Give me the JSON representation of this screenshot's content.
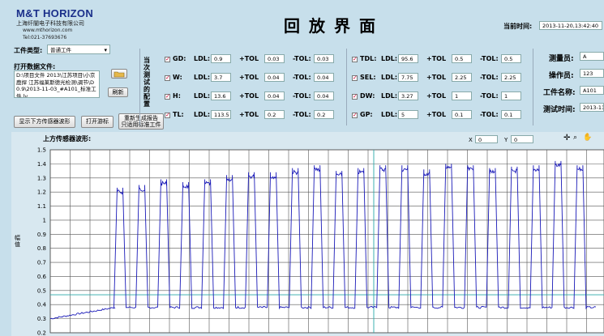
{
  "header": {
    "logo": "M&T HORIZON",
    "company": "上海纤闇电子科技有限公司",
    "website": "www.mthorizon.com",
    "phone": "Tel:021-37693676",
    "title": "回放界面",
    "time_label": "当前时间:",
    "time_value": "2013-11-20,13:42:40"
  },
  "left": {
    "workpiece_type_label": "工件类型:",
    "workpiece_type_value": "普通工件",
    "open_file_label": "打开数据文件:",
    "file_path": "D:\\项目文件 2013\\江苏项目\\小京鹿捍 江苏福莱斯德光检测\\调节\\D0.9\\2013-11-03_#A101_标准工件.lv",
    "refresh_label": "刷新",
    "btn_show_upper": "显示下方传感器波形",
    "btn_print": "打开游标",
    "btn_regen": "重新生成报告\n只适用标准工件"
  },
  "config": {
    "side_label": "当次测试的配置",
    "rows_left": [
      {
        "name": "GD:",
        "ldl": "0.9",
        "ptol": "0.03",
        "mtol": "0.03"
      },
      {
        "name": "W:",
        "ldl": "3.7",
        "ptol": "0.04",
        "mtol": "0.04"
      },
      {
        "name": "H:",
        "ldl": "13.6",
        "ptol": "0.04",
        "mtol": "0.04"
      },
      {
        "name": "TL:",
        "ldl": "113.5",
        "ptol": "0.2",
        "mtol": "0.2"
      }
    ],
    "rows_right": [
      {
        "name": "TDL:",
        "ldl": "95.6",
        "ptol": "0.5",
        "mtol": "0.5"
      },
      {
        "name": "SEL:",
        "ldl": "7.75",
        "ptol": "2.25",
        "mtol": "2.25"
      },
      {
        "name": "DW:",
        "ldl": "3.27",
        "ptol": "1",
        "mtol": "1"
      },
      {
        "name": "GP:",
        "ldl": "5",
        "ptol": "0.1",
        "mtol": "0.1"
      }
    ],
    "ldl_label": "LDL:",
    "ptol_label": "+TOL",
    "mtol_label": "-TOL:"
  },
  "info": {
    "inspector_label": "测量员:",
    "inspector_value": "A",
    "operator_label": "操作员:",
    "operator_value": "123",
    "workpiece_name_label": "工件名称:",
    "workpiece_name_value": "A101",
    "test_time_label": "测试时间:",
    "test_time_value": "2013-11-"
  },
  "chart_data": {
    "type": "line",
    "title": "上方传感器波形:",
    "ylabel": "幅值",
    "xlabel": "",
    "ylim": [
      0.2,
      1.5
    ],
    "yticks": [
      "1.5",
      "1.4",
      "1.3",
      "1.2",
      "1.1",
      "1",
      "0.9",
      "0.8",
      "0.7",
      "0.6",
      "0.5",
      "0.4",
      "0.3",
      "0.2"
    ],
    "cursor_x_label": "X",
    "cursor_x_value": "0",
    "cursor_y_label": "Y",
    "cursor_y_value": "0",
    "grid": true,
    "color": "#1a1ab8",
    "cursor_color": "#2aa8a8",
    "cursor_level": 0.47,
    "baseline_start": 0.3,
    "pulse_floor": 0.38,
    "peaks": [
      1.23,
      1.25,
      1.29,
      1.27,
      1.29,
      1.32,
      1.34,
      1.34,
      1.37,
      1.39,
      1.35,
      1.37,
      1.39,
      1.39,
      1.36,
      1.4,
      1.39,
      1.37,
      1.38,
      1.39,
      1.42,
      1.39
    ]
  }
}
